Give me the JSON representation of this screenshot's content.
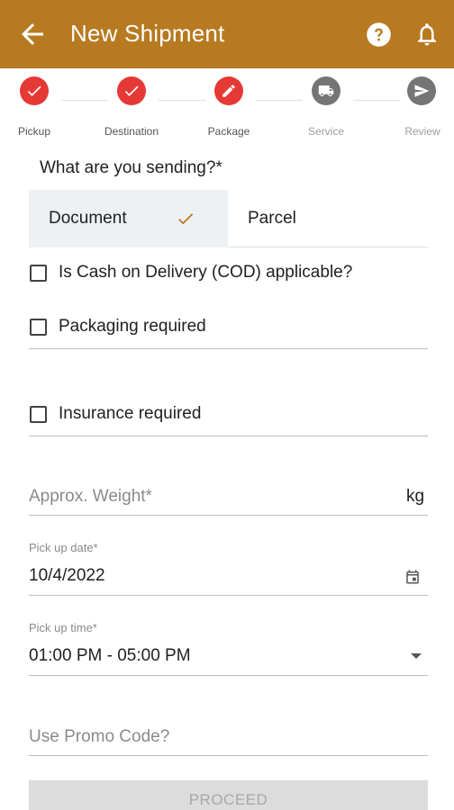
{
  "appbar": {
    "title": "New Shipment",
    "back_icon": "arrow-left-icon",
    "help_icon": "help-circle-icon",
    "notification_icon": "bell-icon",
    "color": "#b77a21"
  },
  "stepper": {
    "steps": [
      {
        "label": "Pickup",
        "state": "done",
        "icon": "check-icon"
      },
      {
        "label": "Destination",
        "state": "done",
        "icon": "check-icon"
      },
      {
        "label": "Package",
        "state": "active",
        "icon": "pencil-icon"
      },
      {
        "label": "Service",
        "state": "pending",
        "icon": "truck-icon"
      },
      {
        "label": "Review",
        "state": "pending",
        "icon": "send-icon"
      }
    ],
    "active_color": "#e53935",
    "pending_color": "#757575"
  },
  "form": {
    "question": "What are you sending?*",
    "types": [
      {
        "label": "Document",
        "selected": true
      },
      {
        "label": "Parcel",
        "selected": false
      }
    ],
    "cod_label": "Is Cash on Delivery (COD) applicable?",
    "packaging_label": "Packaging required",
    "insurance_label": "Insurance required",
    "weight_placeholder": "Approx. Weight*",
    "weight_unit": "kg",
    "pickup_date_label": "Pick up date*",
    "pickup_date_value": "10/4/2022",
    "pickup_time_label": "Pick up time*",
    "pickup_time_value": "01:00 PM - 05:00 PM",
    "promo_placeholder": "Use Promo Code?",
    "proceed_label": "PROCEED"
  }
}
